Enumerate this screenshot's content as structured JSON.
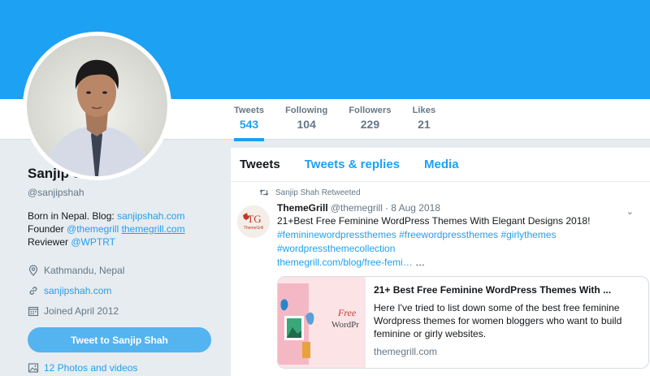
{
  "profile": {
    "name": "Sanjip Shah",
    "handle": "@sanjipshah",
    "bio_prefix1": "Born in Nepal. Blog: ",
    "bio_blog_link": "sanjipshah.com",
    "bio_prefix2": "Founder ",
    "bio_mention1": "@themegrill",
    "bio_link2": "themegrill.com",
    "bio_prefix3": "Reviewer ",
    "bio_mention2": "@WPTRT",
    "location": "Kathmandu, Nepal",
    "website": "sanjipshah.com",
    "joined": "Joined April 2012",
    "tweet_to_label": "Tweet to Sanjip Shah",
    "photos_label": "12 Photos and videos"
  },
  "stats": [
    {
      "label": "Tweets",
      "value": "543"
    },
    {
      "label": "Following",
      "value": "104"
    },
    {
      "label": "Followers",
      "value": "229"
    },
    {
      "label": "Likes",
      "value": "21"
    }
  ],
  "tabs": [
    "Tweets",
    "Tweets & replies",
    "Media"
  ],
  "tweet": {
    "retweet_note": "Sanjip Shah Retweeted",
    "author_name": "ThemeGrill",
    "author_handle": "@themegrill",
    "date": "· 8 Aug 2018",
    "text": "21+Best Free Feminine WordPress Themes With Elegant Designs 2018!",
    "hashtags_line1": "#femininewordpressthemes #freewordpressthemes #girlythemes",
    "hashtags_line2": "#wordpressthemecollection",
    "short_link": "themegrill.com/blog/free-femi…",
    "ellipsis": " …",
    "logo_text": "TG",
    "logo_sub": "ThemeGrill",
    "card": {
      "title": "21+ Best Free Feminine WordPress Themes With ...",
      "description": "Here I've tried to list down some of the best free feminine Wordpress themes for women bloggers who want to build feminine or girly websites.",
      "domain": "themegrill.com",
      "image_text_1": "Free",
      "image_text_2": "WordPr"
    }
  },
  "colors": {
    "accent": "#1da1f2",
    "background": "#e6ecf0",
    "muted": "#657786"
  }
}
